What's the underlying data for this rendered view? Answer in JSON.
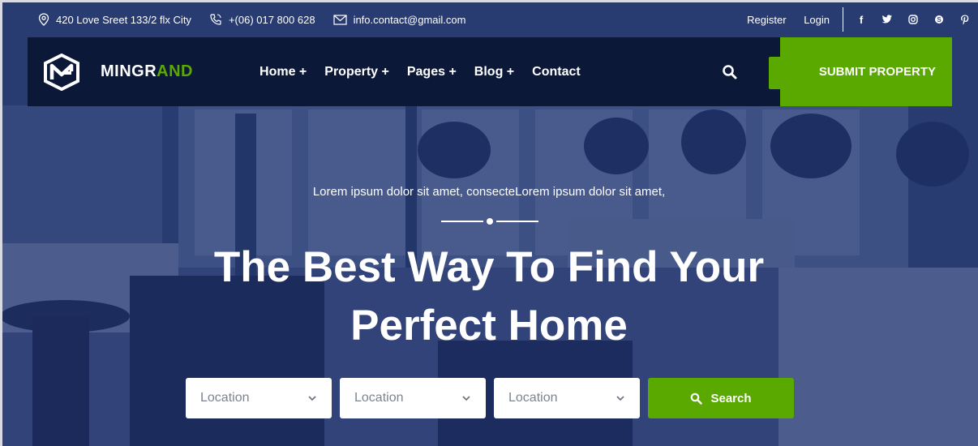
{
  "topbar": {
    "address": "420 Love Sreet 133/2 flx City",
    "phone": "+(06) 017 800 628",
    "email": "info.contact@gmail.com",
    "register": "Register",
    "login": "Login",
    "social": [
      "facebook-icon",
      "twitter-icon",
      "instagram-icon",
      "skype-icon",
      "pinterest-icon"
    ]
  },
  "brand": {
    "name_part1": "MINGR",
    "name_part2": "AND",
    "accent": "#5aa900",
    "navy": "#0c1838"
  },
  "menu": [
    "Home +",
    "Property +",
    "Pages +",
    "Blog +",
    "Contact"
  ],
  "actions": {
    "plus": "+",
    "submit": "SUBMIT PROPERTY"
  },
  "hero": {
    "subtitle": "Lorem ipsum dolor sit amet, consecteLorem ipsum dolor sit amet,",
    "headline_line1": "The Best Way To Find Your",
    "headline_line2": "Perfect Home"
  },
  "search": {
    "selects": [
      "Location",
      "Location",
      "Location"
    ],
    "button": "Search"
  }
}
